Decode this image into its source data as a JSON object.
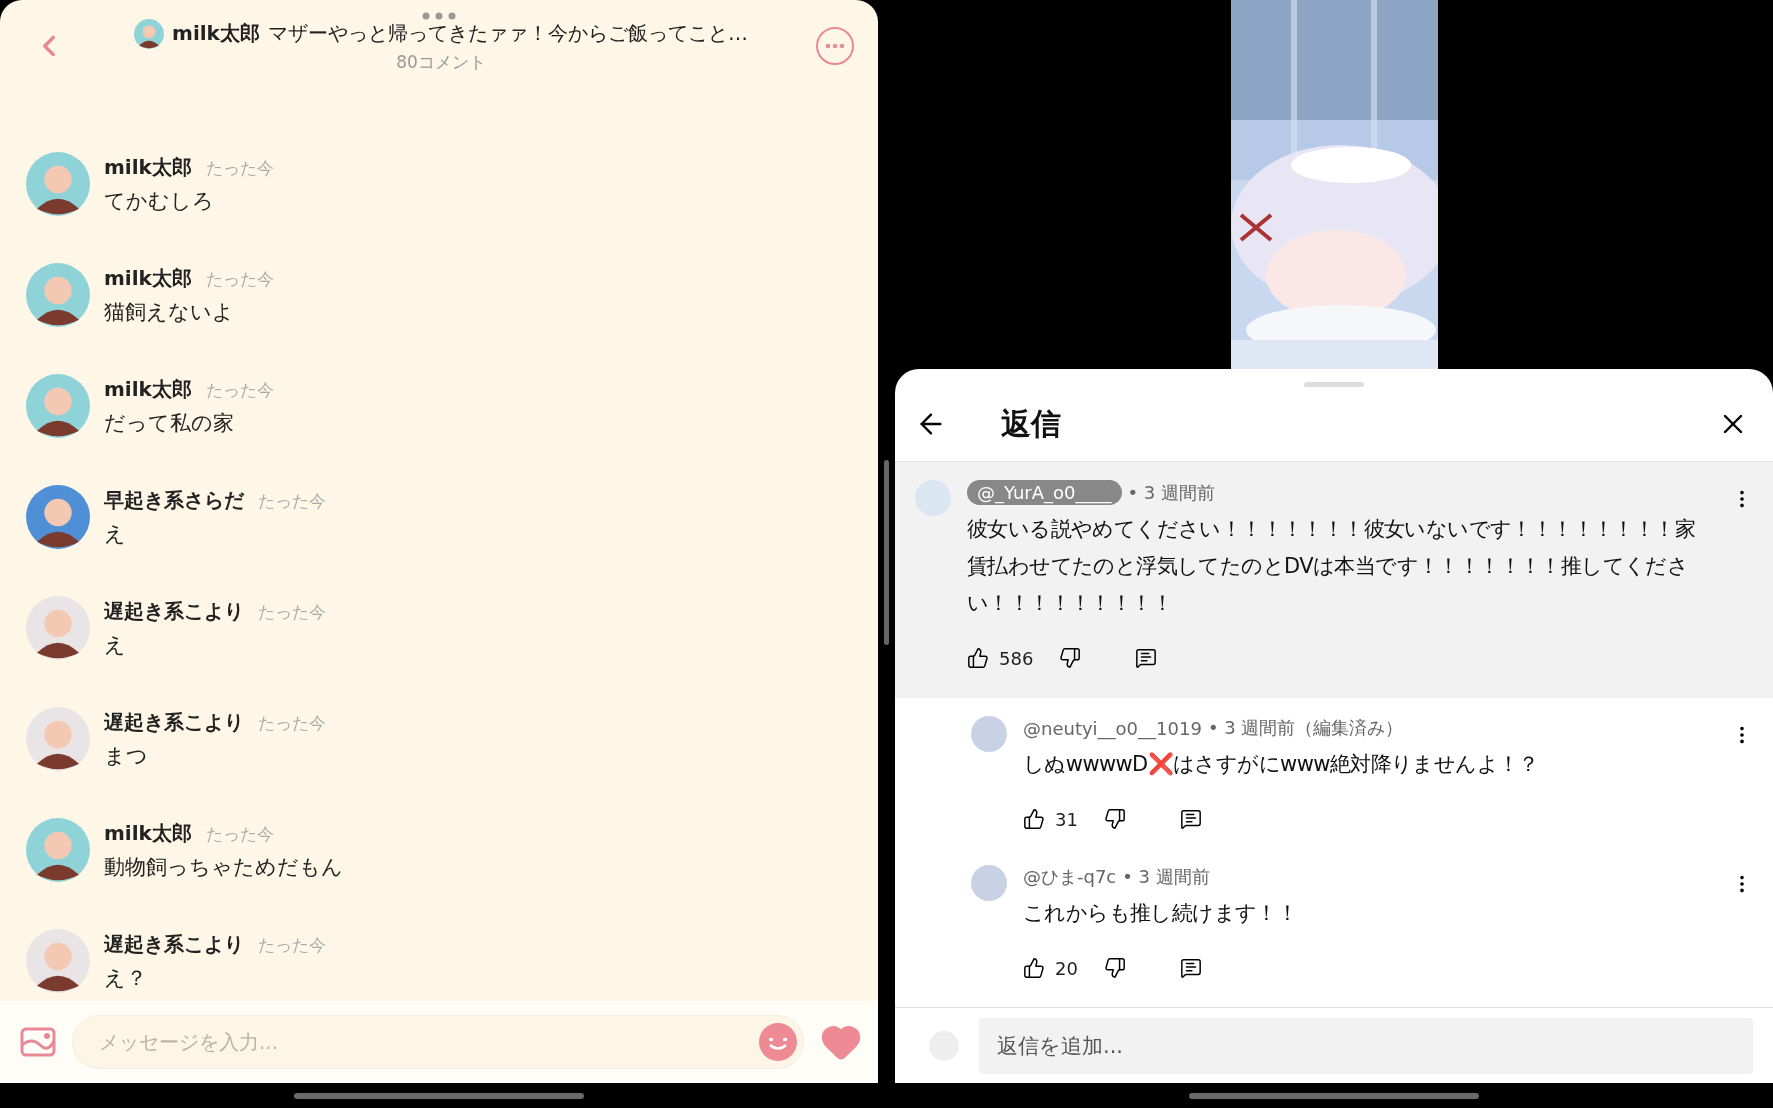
{
  "chat": {
    "header": {
      "author": "milk太郎",
      "title": "マザーやっと帰ってきたァァ！今からご飯ってこと…",
      "comment_count": "80コメント"
    },
    "messages": [
      {
        "name": "milk太郎",
        "time": "たった今",
        "text": "てかむしろ",
        "color": "#8fd3d8"
      },
      {
        "name": "milk太郎",
        "time": "たった今",
        "text": "猫飼えないよ",
        "color": "#8fd3d8"
      },
      {
        "name": "milk太郎",
        "time": "たった今",
        "text": "だって私の家",
        "color": "#8fd3d8"
      },
      {
        "name": "早起き系さらだ",
        "time": "たった今",
        "text": "え",
        "color": "#4f8fd6"
      },
      {
        "name": "遅起き系こより",
        "time": "たった今",
        "text": "え",
        "color": "#e9e4e6"
      },
      {
        "name": "遅起き系こより",
        "time": "たった今",
        "text": "まつ",
        "color": "#e9e4e6"
      },
      {
        "name": "milk太郎",
        "time": "たった今",
        "text": "動物飼っちゃためだもん",
        "color": "#8fd3d8"
      },
      {
        "name": "遅起き系こより",
        "time": "たった今",
        "text": "え？",
        "color": "#e9e4e6"
      }
    ],
    "composer": {
      "placeholder": "メッセージを入力..."
    }
  },
  "replies_sheet": {
    "title": "返信",
    "top_comment": {
      "author": "@_YurA_o0____",
      "meta": "• 3 週間前",
      "text": "彼女いる説やめてください！！！！！！！彼女いないです！！！！！！！！家賃払わせてたのと浮気してたのとDVは本当です！！！！！！！推してください！！！！！！！！！",
      "likes": "586"
    },
    "replies": [
      {
        "author": "@neutyi__o0__1019",
        "meta": "• 3 週間前（編集済み）",
        "text": "しぬwwwwD❌はさすがにwww絶対降りませんよ！？",
        "likes": "31"
      },
      {
        "author": "@ひま-q7c",
        "meta": "• 3 週間前",
        "text": "これからも推し続けます！！",
        "likes": "20"
      }
    ],
    "reply_box": {
      "placeholder": "返信を追加..."
    }
  }
}
